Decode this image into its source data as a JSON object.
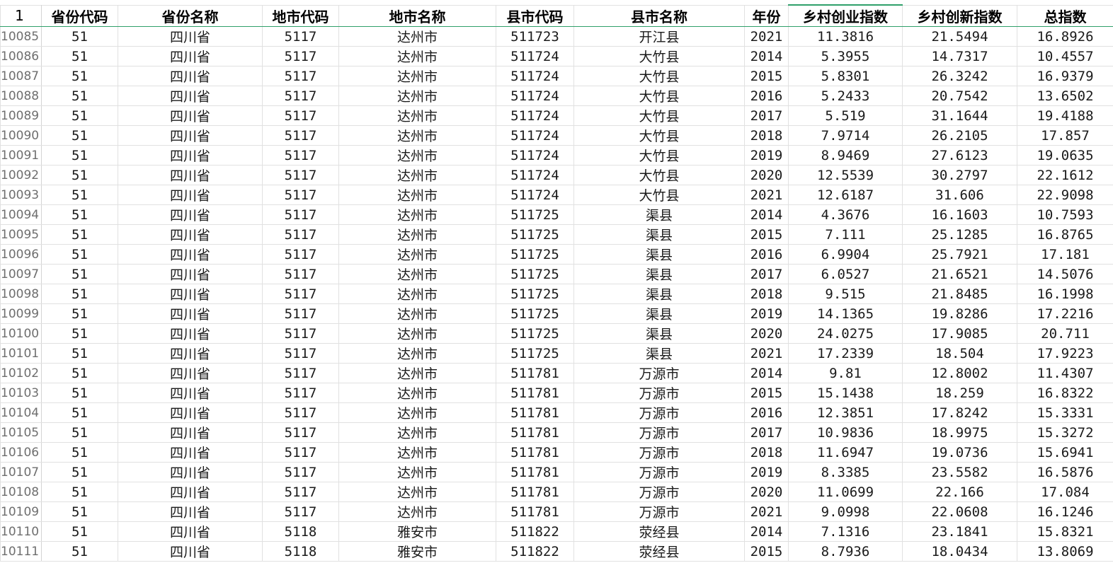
{
  "header": {
    "row_number": "1",
    "columns": [
      "省份代码",
      "省份名称",
      "地市代码",
      "地市名称",
      "县市代码",
      "县市名称",
      "年份",
      "乡村创业指数",
      "乡村创新指数",
      "总指数"
    ]
  },
  "rows": [
    {
      "n": "10085",
      "c": [
        "51",
        "四川省",
        "5117",
        "达州市",
        "511723",
        "开江县",
        "2021",
        "11.3816",
        "21.5494",
        "16.8926"
      ]
    },
    {
      "n": "10086",
      "c": [
        "51",
        "四川省",
        "5117",
        "达州市",
        "511724",
        "大竹县",
        "2014",
        "5.3955",
        "14.7317",
        "10.4557"
      ]
    },
    {
      "n": "10087",
      "c": [
        "51",
        "四川省",
        "5117",
        "达州市",
        "511724",
        "大竹县",
        "2015",
        "5.8301",
        "26.3242",
        "16.9379"
      ]
    },
    {
      "n": "10088",
      "c": [
        "51",
        "四川省",
        "5117",
        "达州市",
        "511724",
        "大竹县",
        "2016",
        "5.2433",
        "20.7542",
        "13.6502"
      ]
    },
    {
      "n": "10089",
      "c": [
        "51",
        "四川省",
        "5117",
        "达州市",
        "511724",
        "大竹县",
        "2017",
        "5.519",
        "31.1644",
        "19.4188"
      ]
    },
    {
      "n": "10090",
      "c": [
        "51",
        "四川省",
        "5117",
        "达州市",
        "511724",
        "大竹县",
        "2018",
        "7.9714",
        "26.2105",
        "17.857"
      ]
    },
    {
      "n": "10091",
      "c": [
        "51",
        "四川省",
        "5117",
        "达州市",
        "511724",
        "大竹县",
        "2019",
        "8.9469",
        "27.6123",
        "19.0635"
      ]
    },
    {
      "n": "10092",
      "c": [
        "51",
        "四川省",
        "5117",
        "达州市",
        "511724",
        "大竹县",
        "2020",
        "12.5539",
        "30.2797",
        "22.1612"
      ]
    },
    {
      "n": "10093",
      "c": [
        "51",
        "四川省",
        "5117",
        "达州市",
        "511724",
        "大竹县",
        "2021",
        "12.6187",
        "31.606",
        "22.9098"
      ]
    },
    {
      "n": "10094",
      "c": [
        "51",
        "四川省",
        "5117",
        "达州市",
        "511725",
        "渠县",
        "2014",
        "4.3676",
        "16.1603",
        "10.7593"
      ]
    },
    {
      "n": "10095",
      "c": [
        "51",
        "四川省",
        "5117",
        "达州市",
        "511725",
        "渠县",
        "2015",
        "7.111",
        "25.1285",
        "16.8765"
      ]
    },
    {
      "n": "10096",
      "c": [
        "51",
        "四川省",
        "5117",
        "达州市",
        "511725",
        "渠县",
        "2016",
        "6.9904",
        "25.7921",
        "17.181"
      ]
    },
    {
      "n": "10097",
      "c": [
        "51",
        "四川省",
        "5117",
        "达州市",
        "511725",
        "渠县",
        "2017",
        "6.0527",
        "21.6521",
        "14.5076"
      ]
    },
    {
      "n": "10098",
      "c": [
        "51",
        "四川省",
        "5117",
        "达州市",
        "511725",
        "渠县",
        "2018",
        "9.515",
        "21.8485",
        "16.1998"
      ]
    },
    {
      "n": "10099",
      "c": [
        "51",
        "四川省",
        "5117",
        "达州市",
        "511725",
        "渠县",
        "2019",
        "14.1365",
        "19.8286",
        "17.2216"
      ]
    },
    {
      "n": "10100",
      "c": [
        "51",
        "四川省",
        "5117",
        "达州市",
        "511725",
        "渠县",
        "2020",
        "24.0275",
        "17.9085",
        "20.711"
      ]
    },
    {
      "n": "10101",
      "c": [
        "51",
        "四川省",
        "5117",
        "达州市",
        "511725",
        "渠县",
        "2021",
        "17.2339",
        "18.504",
        "17.9223"
      ]
    },
    {
      "n": "10102",
      "c": [
        "51",
        "四川省",
        "5117",
        "达州市",
        "511781",
        "万源市",
        "2014",
        "9.81",
        "12.8002",
        "11.4307"
      ]
    },
    {
      "n": "10103",
      "c": [
        "51",
        "四川省",
        "5117",
        "达州市",
        "511781",
        "万源市",
        "2015",
        "15.1438",
        "18.259",
        "16.8322"
      ]
    },
    {
      "n": "10104",
      "c": [
        "51",
        "四川省",
        "5117",
        "达州市",
        "511781",
        "万源市",
        "2016",
        "12.3851",
        "17.8242",
        "15.3331"
      ]
    },
    {
      "n": "10105",
      "c": [
        "51",
        "四川省",
        "5117",
        "达州市",
        "511781",
        "万源市",
        "2017",
        "10.9836",
        "18.9975",
        "15.3272"
      ]
    },
    {
      "n": "10106",
      "c": [
        "51",
        "四川省",
        "5117",
        "达州市",
        "511781",
        "万源市",
        "2018",
        "11.6947",
        "19.0736",
        "15.6941"
      ]
    },
    {
      "n": "10107",
      "c": [
        "51",
        "四川省",
        "5117",
        "达州市",
        "511781",
        "万源市",
        "2019",
        "8.3385",
        "23.5582",
        "16.5876"
      ]
    },
    {
      "n": "10108",
      "c": [
        "51",
        "四川省",
        "5117",
        "达州市",
        "511781",
        "万源市",
        "2020",
        "11.0699",
        "22.166",
        "17.084"
      ]
    },
    {
      "n": "10109",
      "c": [
        "51",
        "四川省",
        "5117",
        "达州市",
        "511781",
        "万源市",
        "2021",
        "9.0998",
        "22.0608",
        "16.1246"
      ]
    },
    {
      "n": "10110",
      "c": [
        "51",
        "四川省",
        "5118",
        "雅安市",
        "511822",
        "荥经县",
        "2014",
        "7.1316",
        "23.1841",
        "15.8321"
      ]
    },
    {
      "n": "10111",
      "c": [
        "51",
        "四川省",
        "5118",
        "雅安市",
        "511822",
        "荥经县",
        "2015",
        "8.7936",
        "18.0434",
        "13.8069"
      ]
    }
  ]
}
